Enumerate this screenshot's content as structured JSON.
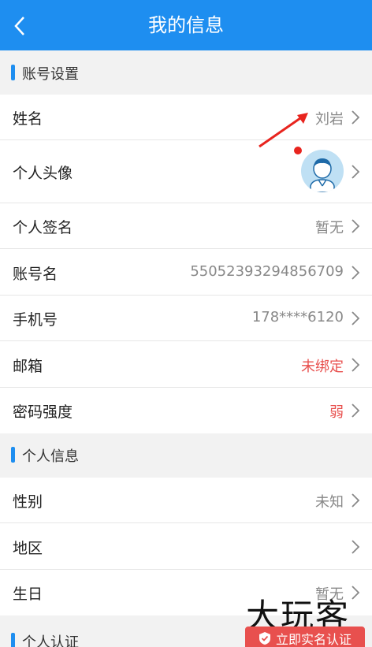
{
  "header": {
    "title": "我的信息"
  },
  "sections": {
    "account": "账号设置",
    "personal": "个人信息",
    "verify": "个人认证"
  },
  "rows": {
    "name": {
      "label": "姓名",
      "value": "刘岩"
    },
    "avatar": {
      "label": "个人头像"
    },
    "signature": {
      "label": "个人签名",
      "value": "暂无"
    },
    "account_name": {
      "label": "账号名",
      "value": "55052393294856709"
    },
    "phone": {
      "label": "手机号",
      "value": "178****6120"
    },
    "email": {
      "label": "邮箱",
      "value": "未绑定"
    },
    "password": {
      "label": "密码强度",
      "value": "弱"
    },
    "gender": {
      "label": "性别",
      "value": "未知"
    },
    "region": {
      "label": "地区",
      "value": ""
    },
    "birthday": {
      "label": "生日",
      "value": "暂无"
    }
  },
  "watermark": "大玩客",
  "verify_button": "立即实名认证",
  "colors": {
    "accent": "#1e8ef0",
    "warning": "#e8504e"
  }
}
